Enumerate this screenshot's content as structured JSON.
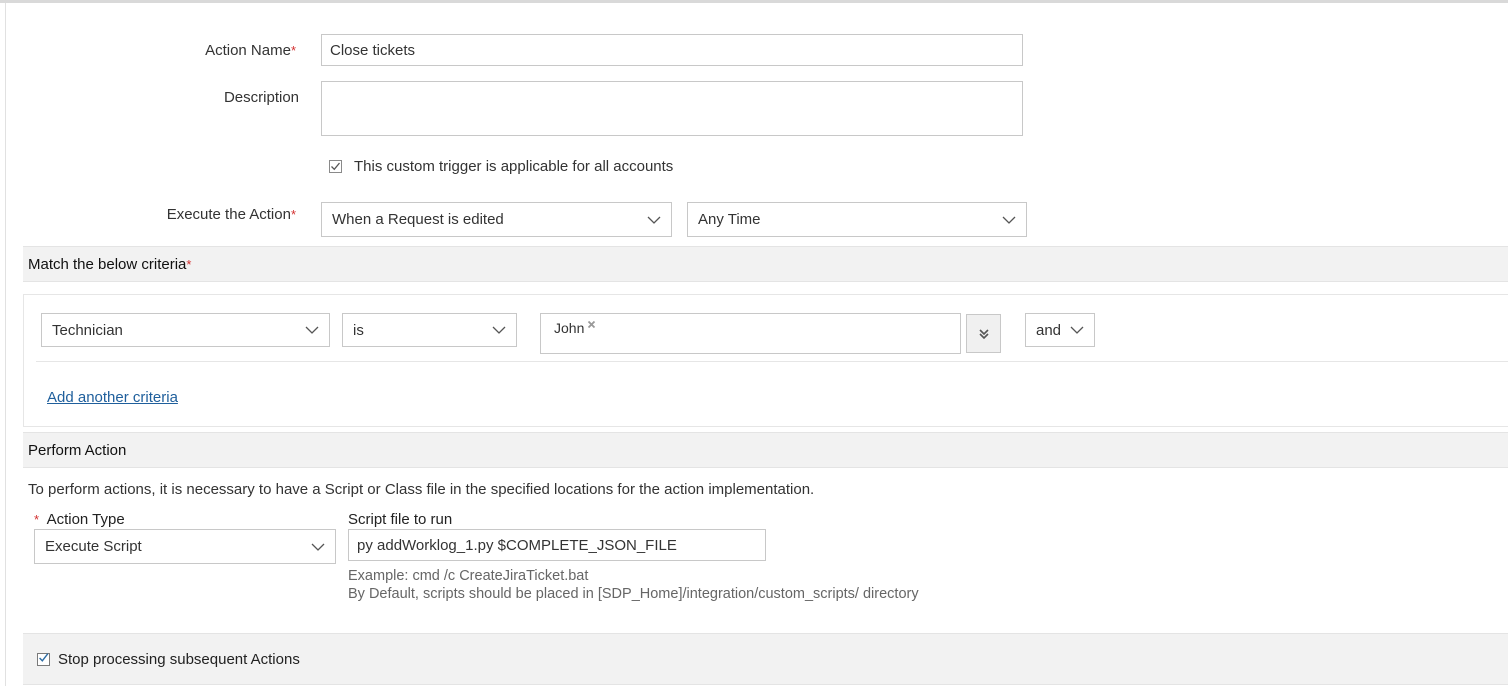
{
  "form": {
    "action_name": {
      "label": "Action Name",
      "required_mark": "*",
      "value": "Close tickets"
    },
    "description": {
      "label": "Description",
      "value": ""
    },
    "all_accounts": {
      "label": "This custom trigger is applicable for all accounts",
      "checked": true
    },
    "execute": {
      "label": "Execute the Action",
      "required_mark": "*",
      "event": "When a Request is edited",
      "time": "Any Time"
    }
  },
  "criteria": {
    "header": "Match the below criteria",
    "required_mark": "*",
    "rows": [
      {
        "field": "Technician",
        "operator": "is",
        "values": [
          "John"
        ],
        "conjunction": "and"
      }
    ],
    "add_link": "Add another criteria"
  },
  "perform": {
    "header": "Perform Action",
    "note": "To perform actions, it is necessary to have a Script or Class file in the specified locations for the action implementation.",
    "action_type": {
      "label": "Action Type",
      "required_mark": "*",
      "value": "Execute Script"
    },
    "script": {
      "label": "Script file to run",
      "value": "py addWorklog_1.py $COMPLETE_JSON_FILE",
      "example": "Example: cmd /c CreateJiraTicket.bat",
      "hint": "By Default, scripts should be placed in [SDP_Home]/integration/custom_scripts/ directory"
    }
  },
  "stop_processing": {
    "label": "Stop processing subsequent Actions",
    "checked": true
  },
  "colors": {
    "required": "#d32f2f",
    "link": "#1f5f9c",
    "check": "#2e6da4"
  }
}
